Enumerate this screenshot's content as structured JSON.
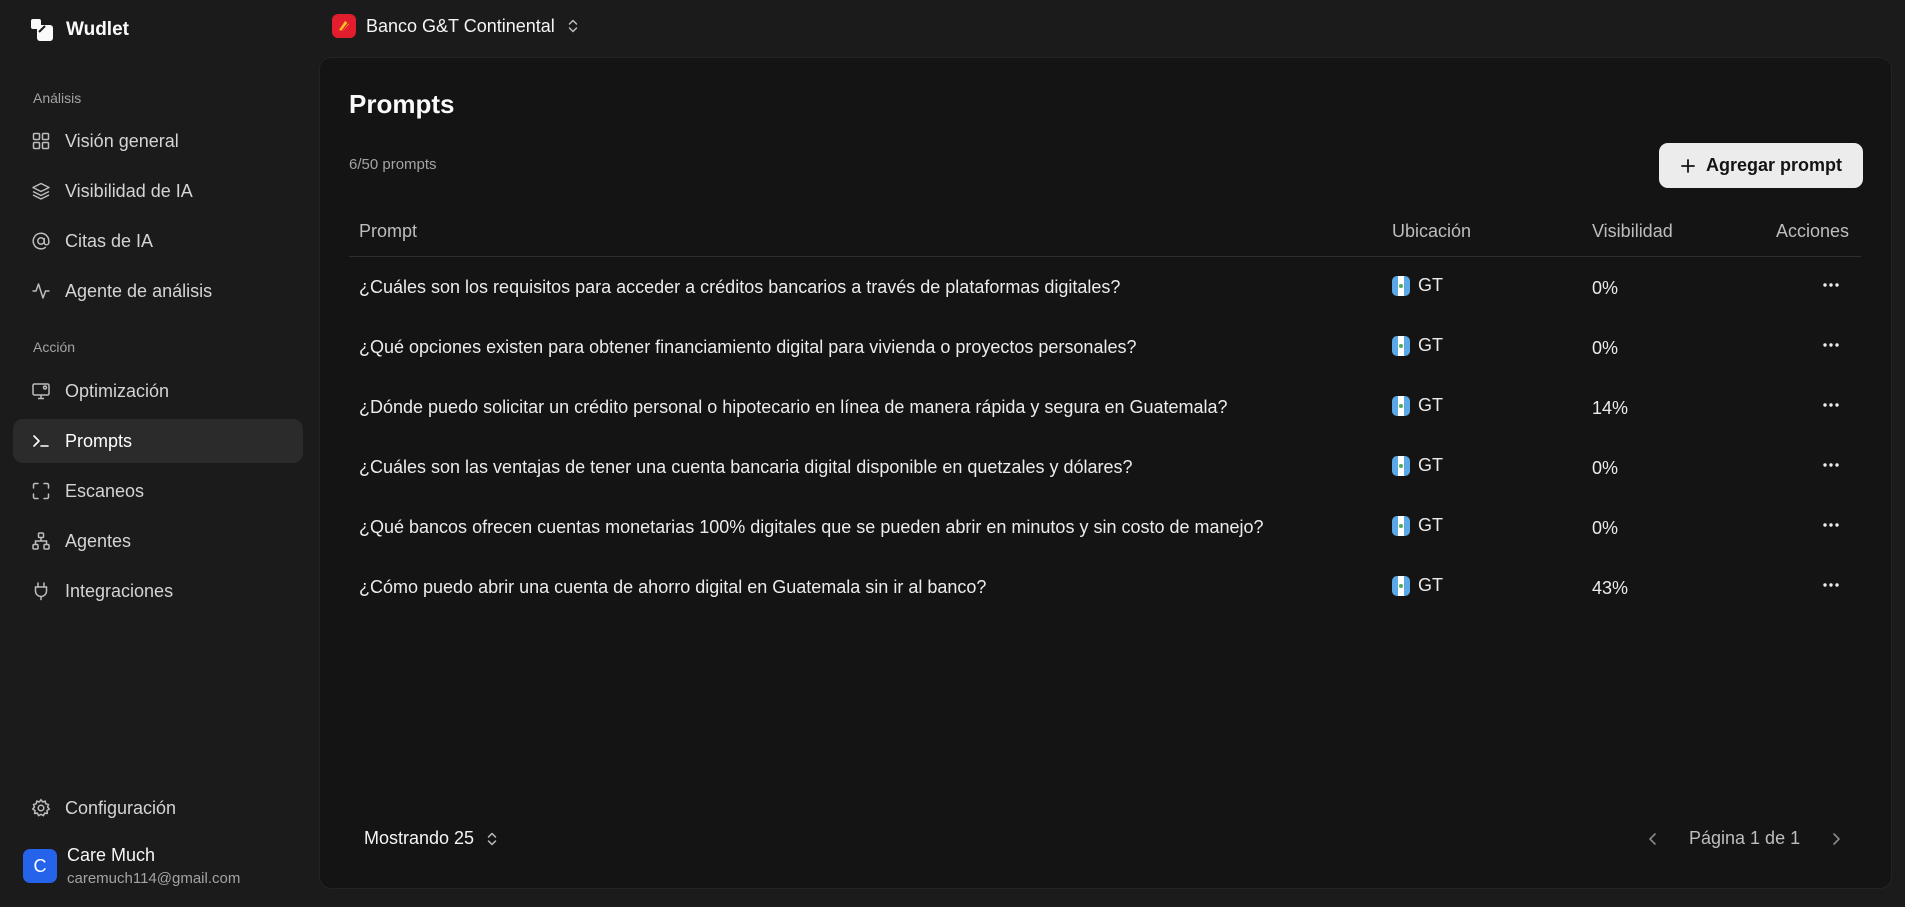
{
  "brand": {
    "name": "Wudlet"
  },
  "sidebar": {
    "section_analysis": "Análisis",
    "section_action": "Acción",
    "items": [
      {
        "label": "Visión general",
        "icon": "grid-icon"
      },
      {
        "label": "Visibilidad de IA",
        "icon": "layers-icon"
      },
      {
        "label": "Citas de IA",
        "icon": "at-sign-icon"
      },
      {
        "label": "Agente de análisis",
        "icon": "activity-icon"
      },
      {
        "label": "Optimización",
        "icon": "monitor-icon"
      },
      {
        "label": "Prompts",
        "icon": "terminal-icon",
        "active": true
      },
      {
        "label": "Escaneos",
        "icon": "scan-icon"
      },
      {
        "label": "Agentes",
        "icon": "network-icon"
      },
      {
        "label": "Integraciones",
        "icon": "plug-icon"
      }
    ],
    "settings": "Configuración"
  },
  "user": {
    "initial": "C",
    "name": "Care Much",
    "email": "caremuch114@gmail.com"
  },
  "workspace": {
    "name": "Banco G&T Continental"
  },
  "main": {
    "title": "Prompts",
    "count": "6/50 prompts",
    "add_button": "Agregar prompt",
    "columns": {
      "prompt": "Prompt",
      "location": "Ubicación",
      "visibility": "Visibilidad",
      "actions": "Acciones"
    },
    "rows": [
      {
        "prompt": "¿Cuáles son los requisitos para acceder a créditos bancarios a través de plataformas digitales?",
        "location": "GT",
        "visibility": "0%"
      },
      {
        "prompt": "¿Qué opciones existen para obtener financiamiento digital para vivienda o proyectos personales?",
        "location": "GT",
        "visibility": "0%"
      },
      {
        "prompt": "¿Dónde puedo solicitar un crédito personal o hipotecario en línea de manera rápida y segura en Guatemala?",
        "location": "GT",
        "visibility": "14%"
      },
      {
        "prompt": "¿Cuáles son las ventajas de tener una cuenta bancaria digital disponible en quetzales y dólares?",
        "location": "GT",
        "visibility": "0%"
      },
      {
        "prompt": "¿Qué bancos ofrecen cuentas monetarias 100% digitales que se pueden abrir en minutos y sin costo de manejo?",
        "location": "GT",
        "visibility": "0%"
      },
      {
        "prompt": "¿Cómo puedo abrir una cuenta de ahorro digital en Guatemala sin ir al banco?",
        "location": "GT",
        "visibility": "43%"
      }
    ],
    "page_size": "Mostrando 25",
    "pagination": "Página 1 de 1"
  }
}
